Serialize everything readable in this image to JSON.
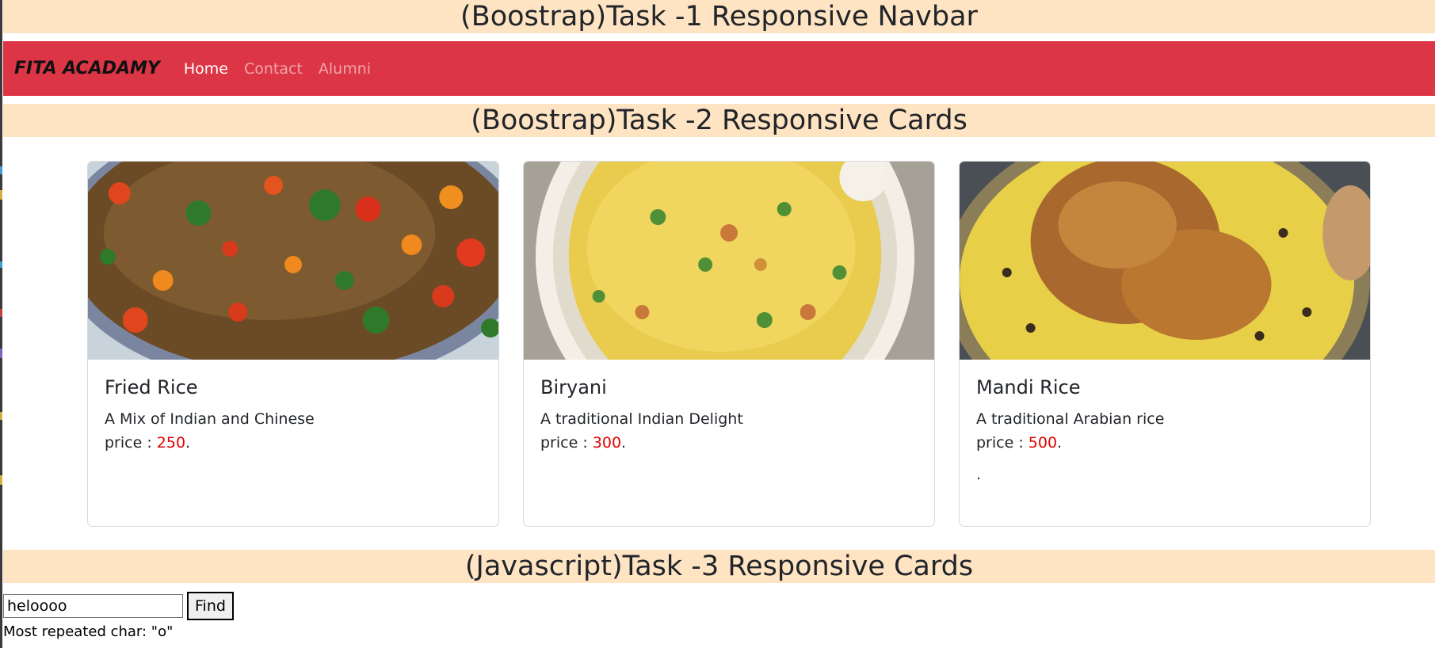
{
  "sections": {
    "task1": "(Boostrap)Task -1 Responsive Navbar",
    "task2": "(Boostrap)Task -2 Responsive Cards",
    "task3": "(Javascript)Task -3 Responsive Cards"
  },
  "navbar": {
    "brand": "FITA ACADAMY",
    "links": [
      "Home",
      "Contact",
      "Alumni"
    ],
    "bg_color": "#dc3545"
  },
  "cards": [
    {
      "title": "Fried Rice",
      "text": "A Mix of Indian and Chinese",
      "price_label": "price :",
      "price": "250",
      "suffix": ".",
      "extra": ""
    },
    {
      "title": "Biryani",
      "text": "A traditional Indian Delight",
      "price_label": "price :",
      "price": "300",
      "suffix": ".",
      "extra": ""
    },
    {
      "title": "Mandi Rice",
      "text": "A traditional Arabian rice",
      "price_label": "price :",
      "price": "500",
      "suffix": ".",
      "extra": "."
    }
  ],
  "finder": {
    "input_value": "heloooo",
    "button_label": "Find",
    "result": "Most repeated char: \"o\""
  },
  "colors": {
    "heading_bg": "#ffe4c4",
    "price": "#e00000"
  }
}
